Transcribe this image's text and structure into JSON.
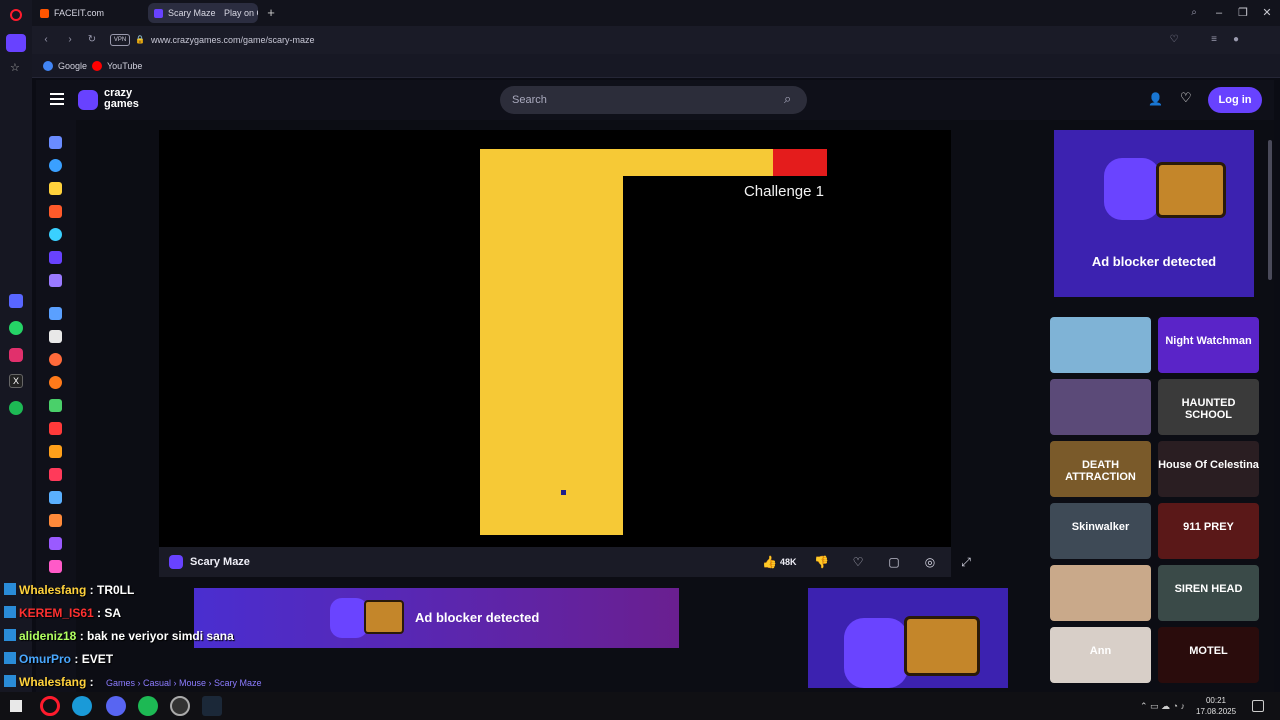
{
  "browser": {
    "tabs": [
      {
        "label": "FACEIT.com",
        "color": "#ff5500"
      },
      {
        "label": "Scary Maze",
        "color": "#6842ff"
      },
      {
        "label": "Play on C",
        "color": "#6842ff"
      }
    ],
    "address": {
      "vpn_label": "VPN",
      "url": "www.crazygames.com/game/scary-maze"
    },
    "bookmarks": [
      {
        "label": "Google",
        "color": "#4285f4"
      },
      {
        "label": "YouTube",
        "color": "#ff0000"
      }
    ]
  },
  "site": {
    "logo_line1": "crazy",
    "logo_line2": "games",
    "search_placeholder": "Search",
    "login_label": "Log in",
    "accent": "#6842ff"
  },
  "game": {
    "challenge_label": "Challenge 1",
    "title": "Scary Maze",
    "likes": "48K",
    "maze_color": "#f6c936",
    "goal_color": "#e41c1c"
  },
  "ads": {
    "right_text": "Ad blocker detected",
    "bottom_text": "Ad blocker detected"
  },
  "thumbnails": [
    {
      "label": "",
      "bg": "#7fb3d6"
    },
    {
      "label": "Night Watchman",
      "bg": "#5a24c8"
    },
    {
      "label": "",
      "bg": "#5b4a78"
    },
    {
      "label": "HAUNTED SCHOOL",
      "bg": "#3a3a3a"
    },
    {
      "label": "DEATH ATTRACTION",
      "bg": "#7a5a2a"
    },
    {
      "label": "House Of Celestina",
      "bg": "#2a1e22"
    },
    {
      "label": "Skinwalker",
      "bg": "#3e4a56"
    },
    {
      "label": "911 PREY",
      "bg": "#5a1818"
    },
    {
      "label": "",
      "bg": "#c9a98a"
    },
    {
      "label": "SIREN HEAD",
      "bg": "#3a4a48"
    },
    {
      "label": "Ann",
      "bg": "#d8cfc8"
    },
    {
      "label": "MOTEL",
      "bg": "#2a0c0c"
    }
  ],
  "breadcrumb": "Games › Casual › Mouse › Scary Maze",
  "chat": [
    {
      "user": "Whalesfang",
      "msg": "TR0LL",
      "color": "#ffd23c"
    },
    {
      "user": "KEREM_IS61",
      "msg": "SA",
      "color": "#ff3030"
    },
    {
      "user": "alideniz18",
      "msg": "bak ne veriyor simdi sana",
      "color": "#b0ff60"
    },
    {
      "user": "OmurPro",
      "msg": "EVET",
      "color": "#4aa8ff"
    },
    {
      "user": "Whalesfang",
      "msg": "",
      "color": "#ffd23c"
    }
  ],
  "clock": {
    "time": "00:21",
    "date": "17.08.2025"
  }
}
